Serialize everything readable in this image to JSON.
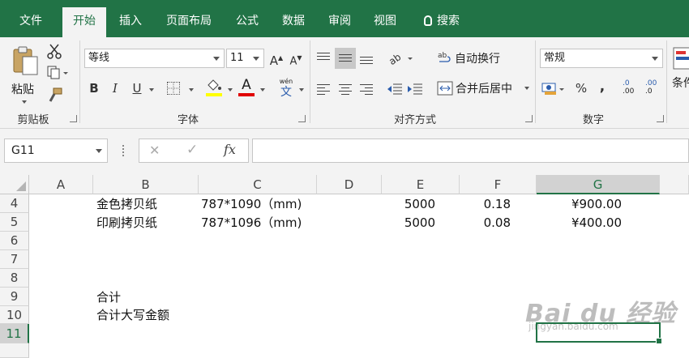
{
  "tabs": [
    {
      "label": "文件",
      "active": false
    },
    {
      "label": "开始",
      "active": true
    },
    {
      "label": "插入",
      "active": false
    },
    {
      "label": "页面布局",
      "active": false
    },
    {
      "label": "公式",
      "active": false
    },
    {
      "label": "数据",
      "active": false
    },
    {
      "label": "审阅",
      "active": false
    },
    {
      "label": "视图",
      "active": false
    }
  ],
  "search_label": "搜索",
  "ribbon": {
    "clipboard": {
      "paste_label": "粘贴",
      "group_label": "剪贴板"
    },
    "font": {
      "font_name": "等线",
      "font_size": "11",
      "bold": "B",
      "italic": "I",
      "underline": "U",
      "text_color_glyph": "A",
      "phonetic_glyph": "wén",
      "phonetic_char": "文",
      "group_label": "字体",
      "grow_glyph": "A",
      "shrink_glyph": "A"
    },
    "alignment": {
      "wrap_label": "自动换行",
      "merge_label": "合并后居中",
      "group_label": "对齐方式"
    },
    "number": {
      "format": "常规",
      "percent": "%",
      "comma": ",",
      "inc_decimal": ".00",
      "dec_decimal": ".0",
      "group_label": "数字"
    },
    "conditional_partial": "条件"
  },
  "formula_bar": {
    "cell_ref": "G11",
    "cancel": "✕",
    "enter": "✓",
    "fx": "fx",
    "content": ""
  },
  "columns": [
    "A",
    "B",
    "C",
    "D",
    "E",
    "F",
    "G"
  ],
  "selected_column": "G",
  "rows": [
    "4",
    "5",
    "6",
    "7",
    "8",
    "9",
    "10",
    "11"
  ],
  "selected_row": "11",
  "cells": {
    "r4": {
      "b": "金色拷贝纸",
      "c": "787*1090（mm)",
      "e": "5000",
      "f": "0.18",
      "g": "¥900.00"
    },
    "r5": {
      "b": "印刷拷贝纸",
      "c": "787*1096（mm)",
      "e": "5000",
      "f": "0.08",
      "g": "¥400.00"
    },
    "r9": {
      "b": "合计"
    },
    "r10": {
      "b": "合计大写金额"
    }
  },
  "watermark": {
    "text": "Bai du 经验",
    "url": "jingyan.baidu.com"
  },
  "colors": {
    "brand": "#217346",
    "highlight": "#ffff00",
    "font_color": "#e00000"
  }
}
